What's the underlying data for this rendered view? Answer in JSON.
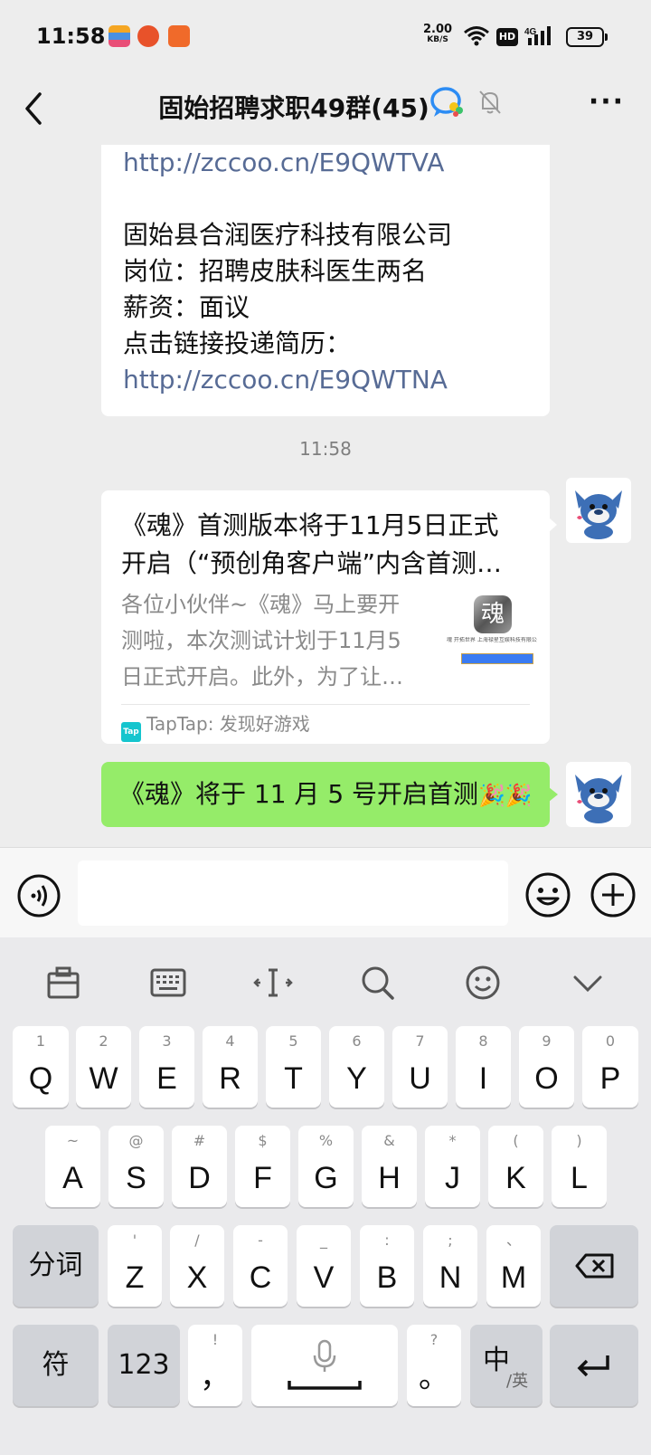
{
  "status_bar": {
    "time": "11:58",
    "net_speed": "2.00",
    "net_unit": "KB/S",
    "hd": "HD",
    "network": "4G",
    "battery": "39"
  },
  "nav": {
    "title": "固始招聘求职49群(45)"
  },
  "messages": {
    "prev_lines": [
      "http://zccoo.cn/E9QWTVA",
      "固始县合润医疗科技有限公司",
      "岗位：招聘皮肤科医生两名",
      "薪资：面议",
      "点击链接投递简历：",
      "http://zccoo.cn/E9QWTNA"
    ],
    "timestamp": "11:58",
    "card": {
      "title_line1": "《魂》首测版本将于11月5日正式",
      "title_line2": "开启（“预创角客户端”内含首测…",
      "desc_line1": "各位小伙伴~《魂》马上要开",
      "desc_line2": "测啦，本次测试计划于11月5",
      "desc_line3": "日正式开启。此外，为了让…",
      "thumb_logo": "魂",
      "thumb_caption": "魂 开拓世界 上海禄星互娱科技有限公司 for",
      "source_icon": "Tap",
      "source": "TapTap: 发现好游戏"
    },
    "sent_text": "《魂》将于 11 月 5 号开启首测",
    "sent_emoji": "🎉🎉"
  },
  "input_bar": {
    "placeholder": ""
  },
  "keyboard": {
    "row1": [
      {
        "sub": "1",
        "main": "Q"
      },
      {
        "sub": "2",
        "main": "W"
      },
      {
        "sub": "3",
        "main": "E"
      },
      {
        "sub": "4",
        "main": "R"
      },
      {
        "sub": "5",
        "main": "T"
      },
      {
        "sub": "6",
        "main": "Y"
      },
      {
        "sub": "7",
        "main": "U"
      },
      {
        "sub": "8",
        "main": "I"
      },
      {
        "sub": "9",
        "main": "O"
      },
      {
        "sub": "0",
        "main": "P"
      }
    ],
    "row2": [
      {
        "sub": "~",
        "main": "A"
      },
      {
        "sub": "@",
        "main": "S"
      },
      {
        "sub": "#",
        "main": "D"
      },
      {
        "sub": "$",
        "main": "F"
      },
      {
        "sub": "%",
        "main": "G"
      },
      {
        "sub": "&",
        "main": "H"
      },
      {
        "sub": "*",
        "main": "J"
      },
      {
        "sub": "(",
        "main": "K"
      },
      {
        "sub": ")",
        "main": "L"
      }
    ],
    "row3": [
      {
        "sub": "'",
        "main": "Z"
      },
      {
        "sub": "/",
        "main": "X"
      },
      {
        "sub": "-",
        "main": "C"
      },
      {
        "sub": "_",
        "main": "V"
      },
      {
        "sub": ":",
        "main": "B"
      },
      {
        "sub": ";",
        "main": "N"
      },
      {
        "sub": "、",
        "main": "M"
      }
    ],
    "segment_key": "分词",
    "symbol_key": "符",
    "num_key": "123",
    "comma_sub": "!",
    "comma_main": "，",
    "period_sub": "?",
    "period_main": "。",
    "lang_main": "中",
    "lang_sub": "/英"
  }
}
